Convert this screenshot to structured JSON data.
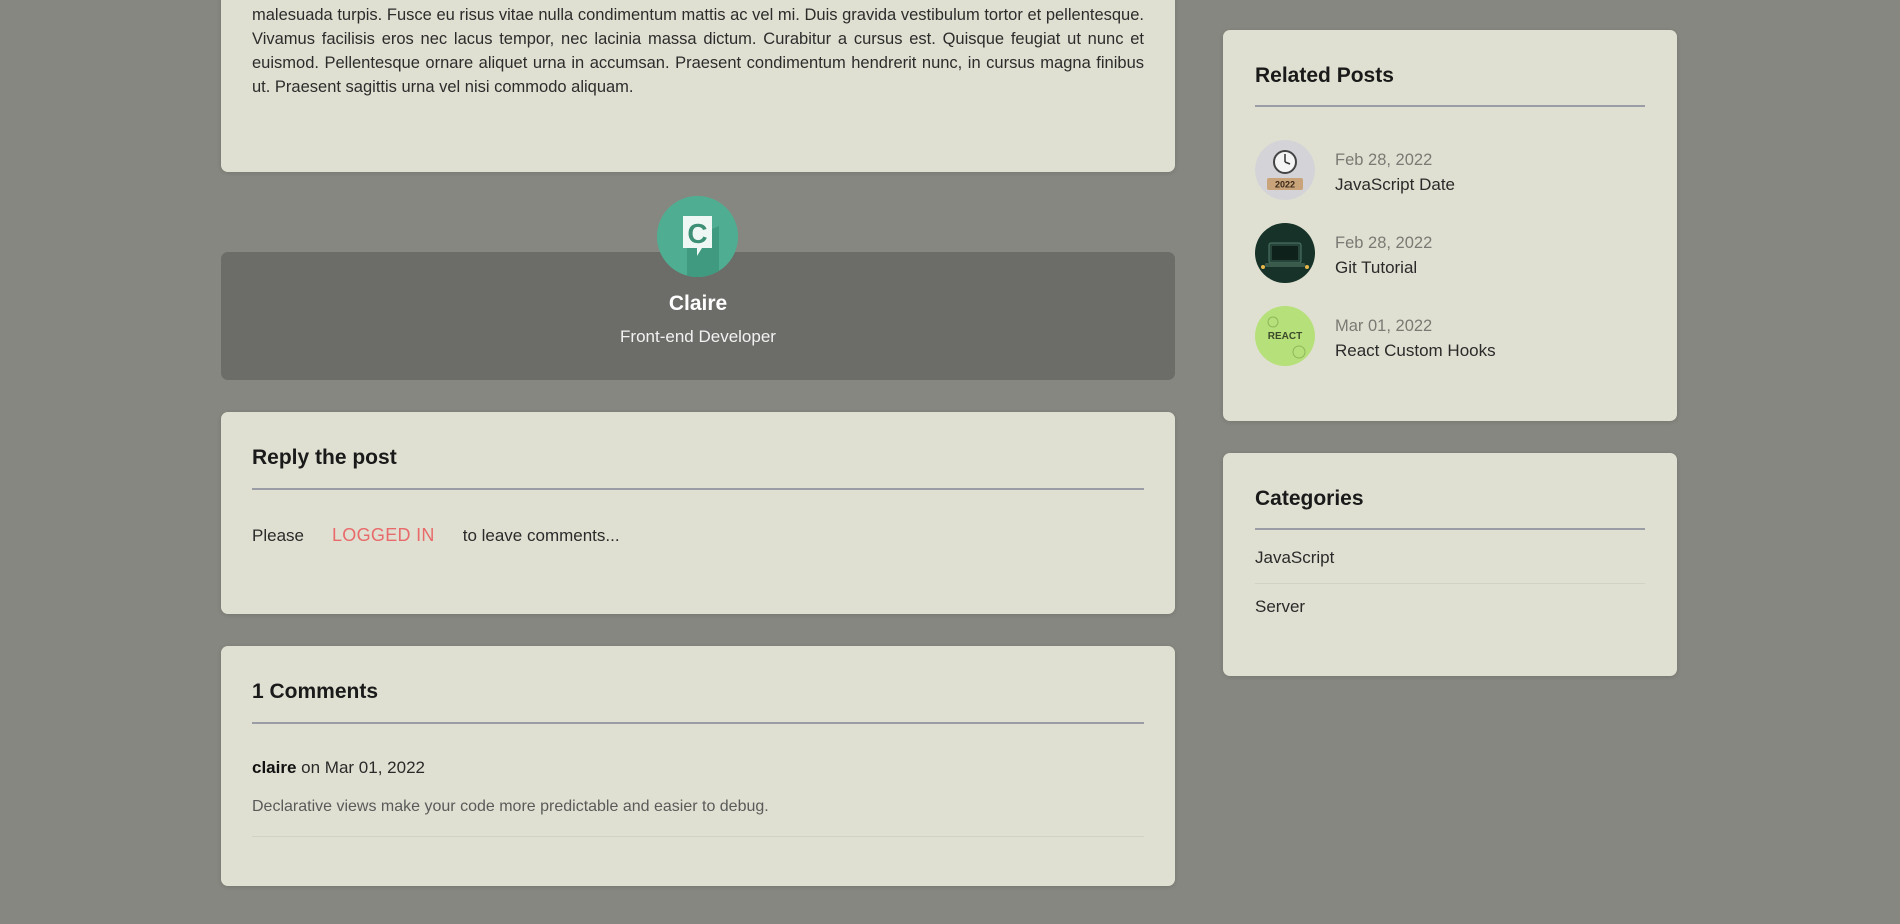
{
  "article": {
    "text": "odio, molestie sed dolor eget, euismod sodales purus. Nam blandit tempor dolor, a gravida lectus iaculis eget. Sed et malesuada turpis. Fusce eu risus vitae nulla condimentum mattis ac vel mi. Duis gravida vestibulum tortor et pellentesque. Vivamus facilisis eros nec lacus tempor, nec lacinia massa dictum. Curabitur a cursus est. Quisque feugiat ut nunc et euismod. Pellentesque ornare aliquet urna in accumsan. Praesent condimentum hendrerit nunc, in cursus magna finibus ut. Praesent sagittis urna vel nisi commodo aliquam."
  },
  "author": {
    "avatar_letter": "C",
    "name": "Claire",
    "role": "Front-end Developer"
  },
  "reply": {
    "title": "Reply the post",
    "prefix": "Please",
    "login_label": "LOGGED IN",
    "suffix": "to leave comments..."
  },
  "comments": {
    "title": "1 Comments",
    "items": [
      {
        "author": "claire",
        "date_text": "on Mar 01, 2022",
        "body": "Declarative views make your code more predictable and easier to debug."
      }
    ]
  },
  "related": {
    "title": "Related Posts",
    "items": [
      {
        "date": "Feb 28, 2022",
        "title": "JavaScript Date",
        "thumb_text": "2022"
      },
      {
        "date": "Feb 28, 2022",
        "title": "Git Tutorial"
      },
      {
        "date": "Mar 01, 2022",
        "title": "React Custom Hooks",
        "thumb_text": "REACT"
      }
    ]
  },
  "categories": {
    "title": "Categories",
    "items": [
      "JavaScript",
      "Server"
    ]
  },
  "colors": {
    "background": "#878781",
    "card": "#e0e0d2",
    "author_box": "#6c6c68",
    "accent_link": "#e86a6a",
    "avatar": "#4fae92"
  }
}
